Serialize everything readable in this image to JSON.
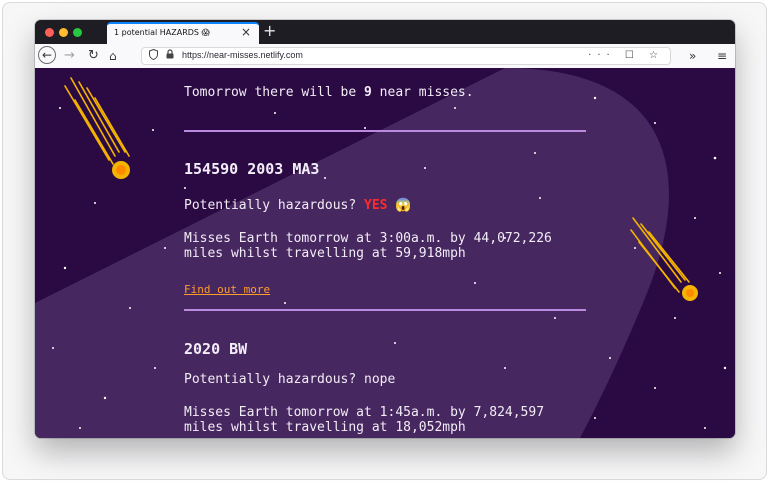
{
  "browser": {
    "tab_title": "1 potential HAZARDS 😱",
    "tab_close": "×",
    "new_tab": "+",
    "url": "https://near-misses.netlify.com",
    "back_icon": "←",
    "forward_icon": "→",
    "reload_icon": "↻",
    "home_icon": "⌂",
    "url_actions": "··· ☐ ☆",
    "more_icon": "»",
    "menu_icon": "≡"
  },
  "page": {
    "intro_prefix": "Tomorrow there will be ",
    "intro_count": "9",
    "intro_suffix": " near misses.",
    "asteroids": [
      {
        "name": "154590 2003 MA3",
        "hazard_label": "Potentially hazardous? ",
        "hazard_value": "YES",
        "hazard_emoji": "😱",
        "description": "Misses Earth tomorrow at 3:00a.m. by 44,072,226 miles whilst travelling at 59,918mph",
        "link": "Find out more"
      },
      {
        "name": "2020 BW",
        "hazard_label": "Potentially hazardous? ",
        "hazard_value": "nope",
        "description": "Misses Earth tomorrow at 1:45a.m. by 7,824,597 miles whilst travelling at 18,052mph"
      }
    ]
  },
  "colors": {
    "background": "#2b0a43",
    "beam": "#4a2a63",
    "divider": "#b98ae0",
    "hazard_yes": "#ff2a2a",
    "link": "#ff9d2a",
    "meteor": "#f5b400"
  }
}
